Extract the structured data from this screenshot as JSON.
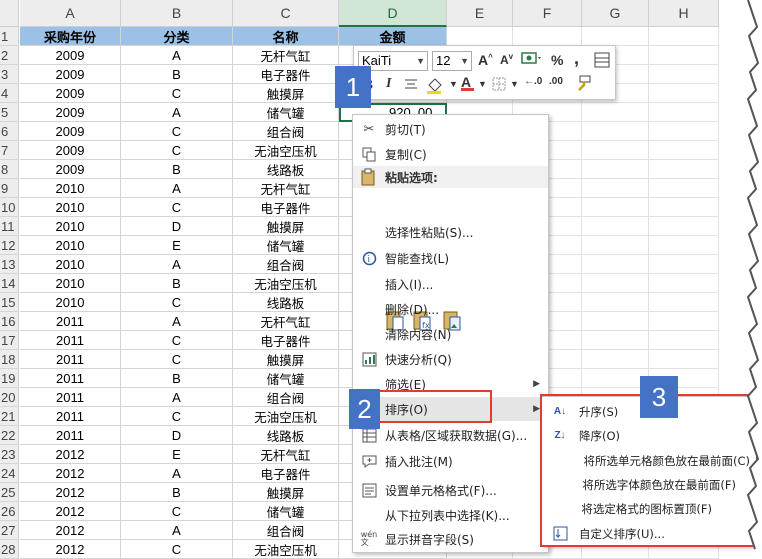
{
  "columns": [
    "A",
    "B",
    "C",
    "D",
    "E",
    "F",
    "G",
    "H"
  ],
  "selected_column": "D",
  "table": {
    "headers": [
      "采购年份",
      "分类",
      "名称",
      "金额"
    ],
    "rows": [
      [
        "2009",
        "A",
        "无杆气缸"
      ],
      [
        "2009",
        "B",
        "电子器件"
      ],
      [
        "2009",
        "C",
        "触摸屏"
      ],
      [
        "2009",
        "A",
        "储气罐"
      ],
      [
        "2009",
        "C",
        "组合阀"
      ],
      [
        "2009",
        "C",
        "无油空压机"
      ],
      [
        "2009",
        "B",
        "线路板"
      ],
      [
        "2010",
        "A",
        "无杆气缸"
      ],
      [
        "2010",
        "C",
        "电子器件"
      ],
      [
        "2010",
        "D",
        "触摸屏"
      ],
      [
        "2010",
        "E",
        "储气罐"
      ],
      [
        "2010",
        "A",
        "组合阀"
      ],
      [
        "2010",
        "B",
        "无油空压机"
      ],
      [
        "2010",
        "C",
        "线路板"
      ],
      [
        "2011",
        "A",
        "无杆气缸"
      ],
      [
        "2011",
        "C",
        "电子器件"
      ],
      [
        "2011",
        "C",
        "触摸屏"
      ],
      [
        "2011",
        "B",
        "储气罐"
      ],
      [
        "2011",
        "A",
        "组合阀"
      ],
      [
        "2011",
        "C",
        "无油空压机"
      ],
      [
        "2011",
        "D",
        "线路板"
      ],
      [
        "2012",
        "E",
        "无杆气缸"
      ],
      [
        "2012",
        "A",
        "电子器件"
      ],
      [
        "2012",
        "B",
        "触摸屏"
      ],
      [
        "2012",
        "C",
        "储气罐"
      ],
      [
        "2012",
        "A",
        "组合阀"
      ],
      [
        "2012",
        "C",
        "无油空压机"
      ]
    ],
    "visible_amount": "920. 00"
  },
  "row_numbers": [
    "1",
    "2",
    "3",
    "4",
    "5",
    "6",
    "7",
    "8",
    "9",
    "10",
    "11",
    "12",
    "13",
    "14",
    "15",
    "16",
    "17",
    "18",
    "19",
    "20",
    "21",
    "22",
    "23",
    "24",
    "25",
    "26",
    "27",
    "28"
  ],
  "mini_toolbar": {
    "font_name": "KaiTi",
    "font_size": "12",
    "percent": "%",
    "comma": ",",
    "bold": "B",
    "italic": "I",
    "font_color_letter": "A",
    "increase_font": "A",
    "decrease_font": "A"
  },
  "badges": {
    "one": "1",
    "two": "2",
    "three": "3"
  },
  "context_menu": {
    "cut": "剪切(T)",
    "copy": "复制(C)",
    "paste_options": "粘贴选项:",
    "paste_special": "选择性粘贴(S)...",
    "smart_lookup": "智能查找(L)",
    "insert": "插入(I)...",
    "delete": "删除(D)...",
    "clear": "清除内容(N)",
    "quick_analysis": "快速分析(Q)",
    "filter": "筛选(E)",
    "sort": "排序(O)",
    "get_data": "从表格/区域获取数据(G)...",
    "insert_comment": "插入批注(M)",
    "format_cells": "设置单元格格式(F)...",
    "pick_from_list": "从下拉列表中选择(K)...",
    "phonetic": "显示拼音字段(S)"
  },
  "sort_submenu": {
    "ascending": "升序(S)",
    "descending": "降序(O)",
    "cell_color_top": "将所选单元格颜色放在最前面(C)",
    "font_color_top": "将所选字体颜色放在最前面(F)",
    "icon_top": "将选定格式的图标置顶(F)",
    "custom_sort": "自定义排序(U)..."
  },
  "colors": {
    "header_fill": "#9bc2e6",
    "badge": "#4472c4",
    "highlight_box": "#e03c31",
    "excel_green": "#217346"
  }
}
